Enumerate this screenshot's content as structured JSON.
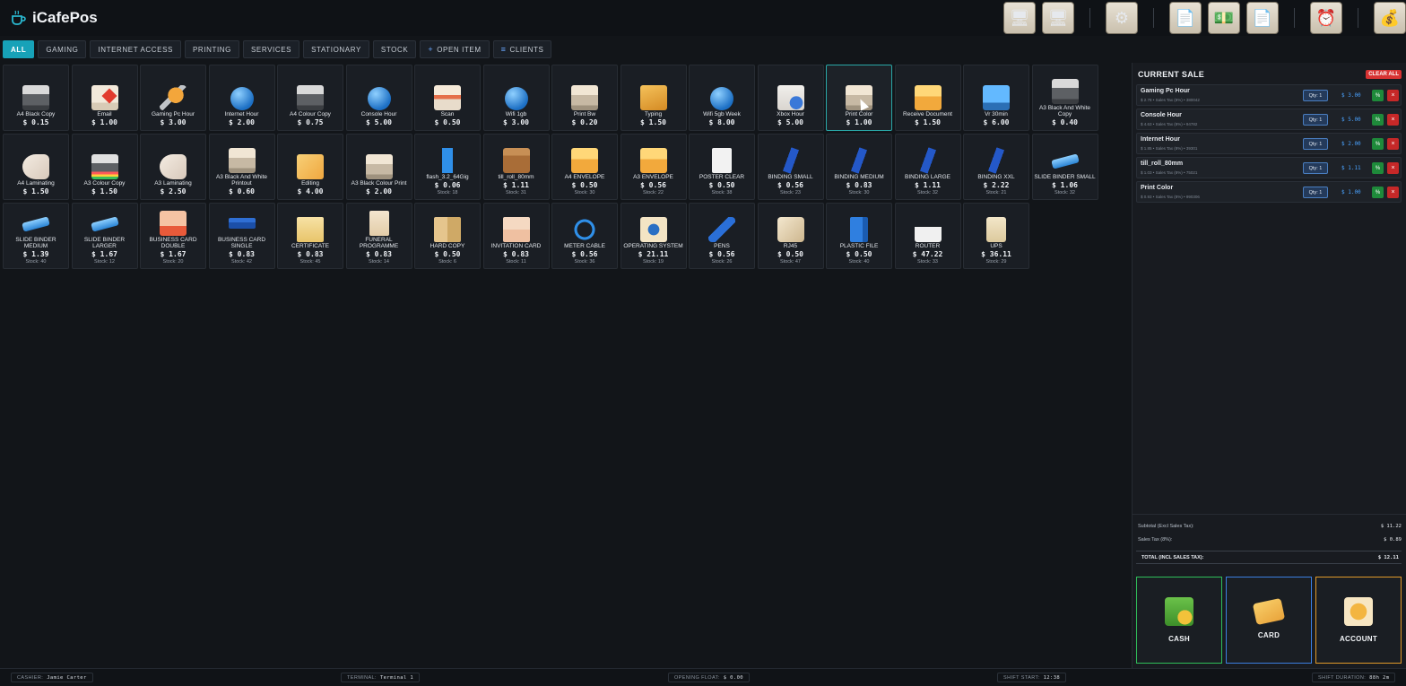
{
  "app": {
    "title": "iCafePos"
  },
  "top_icons": [
    {
      "name": "pc-logout-icon",
      "glyph": "🖥"
    },
    {
      "name": "pc-monitor-icon",
      "glyph": "🖥"
    },
    {
      "name": "settings-gear-icon",
      "glyph": "⚙"
    },
    {
      "name": "receipt-list-icon",
      "glyph": "📄"
    },
    {
      "name": "cash-note-icon",
      "glyph": "💵"
    },
    {
      "name": "document-stamp-icon",
      "glyph": "📄"
    },
    {
      "name": "shift-clock-icon",
      "glyph": "⏰"
    },
    {
      "name": "cash-drawer-icon",
      "glyph": "💰"
    }
  ],
  "tabs": [
    {
      "label": "ALL"
    },
    {
      "label": "GAMING"
    },
    {
      "label": "INTERNET ACCESS"
    },
    {
      "label": "PRINTING"
    },
    {
      "label": "SERVICES"
    },
    {
      "label": "STATIONARY"
    },
    {
      "label": "STOCK"
    },
    {
      "label": "OPEN ITEM",
      "icon": "+"
    },
    {
      "label": "CLIENTS",
      "icon": "≡"
    }
  ],
  "products": [
    {
      "name": "A4 Black Copy",
      "price": "$ 0.15",
      "stock": "",
      "icon": "printer"
    },
    {
      "name": "Email",
      "price": "$ 1.00",
      "stock": "",
      "icon": "email"
    },
    {
      "name": "Gaming Pc Hour",
      "price": "$ 3.00",
      "stock": "",
      "icon": "tools"
    },
    {
      "name": "Internet Hour",
      "price": "$ 2.00",
      "stock": "",
      "icon": "globe"
    },
    {
      "name": "A4 Colour Copy",
      "price": "$ 0.75",
      "stock": "",
      "icon": "printer"
    },
    {
      "name": "Console Hour",
      "price": "$ 5.00",
      "stock": "",
      "icon": "globe"
    },
    {
      "name": "Scan",
      "price": "$ 0.50",
      "stock": "",
      "icon": "scan"
    },
    {
      "name": "Wifi 1gb",
      "price": "$ 3.00",
      "stock": "",
      "icon": "globe"
    },
    {
      "name": "Print Bw",
      "price": "$ 0.20",
      "stock": "",
      "icon": "printer-beige"
    },
    {
      "name": "Typing",
      "price": "$ 1.50",
      "stock": "",
      "icon": "typing"
    },
    {
      "name": "Wifi 5gb Week",
      "price": "$ 8.00",
      "stock": "",
      "icon": "globe"
    },
    {
      "name": "Xbox Hour",
      "price": "$ 5.00",
      "stock": "",
      "icon": "xbox"
    },
    {
      "name": "Print Color",
      "price": "$ 1.00",
      "stock": "",
      "icon": "printer-beige",
      "hover": true
    },
    {
      "name": "Receive Document",
      "price": "$ 1.50",
      "stock": "",
      "icon": "envelope"
    },
    {
      "name": "Vr 30min",
      "price": "$ 6.00",
      "stock": "",
      "icon": "vr"
    },
    {
      "name": "A3 Black And White Copy",
      "price": "$ 0.40",
      "stock": "",
      "icon": "printer"
    },
    {
      "name": "A4 Laminating",
      "price": "$ 1.50",
      "stock": "",
      "icon": "laminate"
    },
    {
      "name": "A3 Colour Copy",
      "price": "$ 1.50",
      "stock": "",
      "icon": "colour"
    },
    {
      "name": "A3 Laminating",
      "price": "$ 2.50",
      "stock": "",
      "icon": "laminate"
    },
    {
      "name": "A3 Black And White Printout",
      "price": "$ 0.60",
      "stock": "",
      "icon": "printer-beige"
    },
    {
      "name": "Editing",
      "price": "$ 4.00",
      "stock": "",
      "icon": "editing"
    },
    {
      "name": "A3 Black Colour Print",
      "price": "$ 2.00",
      "stock": "",
      "icon": "printer-beige"
    },
    {
      "name": "flash_3.2_64Gig",
      "price": "$ 0.06",
      "stock": "Stock: 18",
      "icon": "usb"
    },
    {
      "name": "till_roll_80mm",
      "price": "$ 1.11",
      "stock": "Stock: 31",
      "icon": "box"
    },
    {
      "name": "A4 ENVELOPE",
      "price": "$ 0.50",
      "stock": "Stock: 30",
      "icon": "envelope"
    },
    {
      "name": "A3 ENVELOPE",
      "price": "$ 0.56",
      "stock": "Stock: 22",
      "icon": "envelope"
    },
    {
      "name": "POSTER CLEAR",
      "price": "$ 0.50",
      "stock": "Stock: 38",
      "icon": "poster"
    },
    {
      "name": "BINDING SMALL",
      "price": "$ 0.56",
      "stock": "Stock: 23",
      "icon": "binding"
    },
    {
      "name": "BINDING MEDIUM",
      "price": "$ 0.83",
      "stock": "Stock: 30",
      "icon": "binding"
    },
    {
      "name": "BINDING LARGE",
      "price": "$ 1.11",
      "stock": "Stock: 32",
      "icon": "binding"
    },
    {
      "name": "BINDING XXL",
      "price": "$ 2.22",
      "stock": "Stock: 21",
      "icon": "binding"
    },
    {
      "name": "SLIDE BINDER SMALL",
      "price": "$ 1.06",
      "stock": "Stock: 32",
      "icon": "slide"
    },
    {
      "name": "SLIDE BINDER MEDIUM",
      "price": "$ 1.39",
      "stock": "Stock: 40",
      "icon": "slide"
    },
    {
      "name": "SLIDE BINDER LARGER",
      "price": "$ 1.67",
      "stock": "Stock: 12",
      "icon": "slide"
    },
    {
      "name": "BUSINESS CARD DOUBLE",
      "price": "$ 1.67",
      "stock": "Stock: 20",
      "icon": "bcard"
    },
    {
      "name": "BUSINESS CARD SINGLE",
      "price": "$ 0.83",
      "stock": "Stock: 42",
      "icon": "bcard2"
    },
    {
      "name": "CERTIFICATE",
      "price": "$ 0.83",
      "stock": "Stock: 45",
      "icon": "cert"
    },
    {
      "name": "FUNERAL PROGRAMME",
      "price": "$ 0.83",
      "stock": "Stock: 14",
      "icon": "funeral"
    },
    {
      "name": "HARD COPY",
      "price": "$ 0.50",
      "stock": "Stock: 6",
      "icon": "hardcopy"
    },
    {
      "name": "INVITATION CARD",
      "price": "$ 0.83",
      "stock": "Stock: 11",
      "icon": "invite"
    },
    {
      "name": "METER CABLE",
      "price": "$ 0.56",
      "stock": "Stock: 36",
      "icon": "cable"
    },
    {
      "name": "OPERATING SYSTEM",
      "price": "$ 21.11",
      "stock": "Stock: 19",
      "icon": "os"
    },
    {
      "name": "PENS",
      "price": "$ 0.56",
      "stock": "Stock: 26",
      "icon": "pen"
    },
    {
      "name": "RJ45",
      "price": "$ 0.50",
      "stock": "Stock: 47",
      "icon": "rj45"
    },
    {
      "name": "PLASTIC FILE",
      "price": "$ 0.50",
      "stock": "Stock: 40",
      "icon": "file"
    },
    {
      "name": "ROUTER",
      "price": "$ 47.22",
      "stock": "Stock: 33",
      "icon": "router"
    },
    {
      "name": "UPS",
      "price": "$ 36.11",
      "stock": "Stock: 29",
      "icon": "ups"
    }
  ],
  "sale": {
    "title": "CURRENT SALE",
    "clear_label": "CLEAR ALL",
    "items": [
      {
        "name": "Gaming Pc Hour",
        "meta": "$ 2.78 • Sales Tax (8%) • 380042",
        "qty": "Qty: 1",
        "price": "$ 3.00"
      },
      {
        "name": "Console Hour",
        "meta": "$ 4.63 • Sales Tax (8%) • 94782",
        "qty": "Qty: 1",
        "price": "$ 5.00"
      },
      {
        "name": "Internet Hour",
        "meta": "$ 1.85 • Sales Tax (8%) • 39301",
        "qty": "Qty: 1",
        "price": "$ 2.00"
      },
      {
        "name": "till_roll_80mm",
        "meta": "$ 1.03 • Sales Tax (8%) • 75021",
        "qty": "Qty: 1",
        "price": "$ 1.11"
      },
      {
        "name": "Print Color",
        "meta": "$ 0.93 • Sales Tax (8%) • 990306",
        "qty": "Qty: 1",
        "price": "$ 1.00"
      }
    ],
    "pct_label": "%",
    "del_label": "×",
    "subtotal_label": "Subtotal (Excl Sales Tax):",
    "subtotal_value": "$ 11.22",
    "tax_label": "Sales Tax (8%):",
    "tax_value": "$ 0.89",
    "total_label": "TOTAL (INCL SALES TAX):",
    "total_value": "$ 12.11"
  },
  "payment": {
    "cash_label": "CASH",
    "card_label": "CARD",
    "account_label": "ACCOUNT"
  },
  "footer": {
    "cashier_label": "CASHIER:",
    "cashier_value": "Jamie Carter",
    "terminal_label": "TERMINAL:",
    "terminal_value": "Terminal 1",
    "float_label": "OPENING FLOAT:",
    "float_value": "$ 0.00",
    "shift_start_label": "SHIFT START:",
    "shift_start_value": "12:38",
    "shift_duration_label": "SHIFT DURATION:",
    "shift_duration_value": "88h 2m"
  }
}
